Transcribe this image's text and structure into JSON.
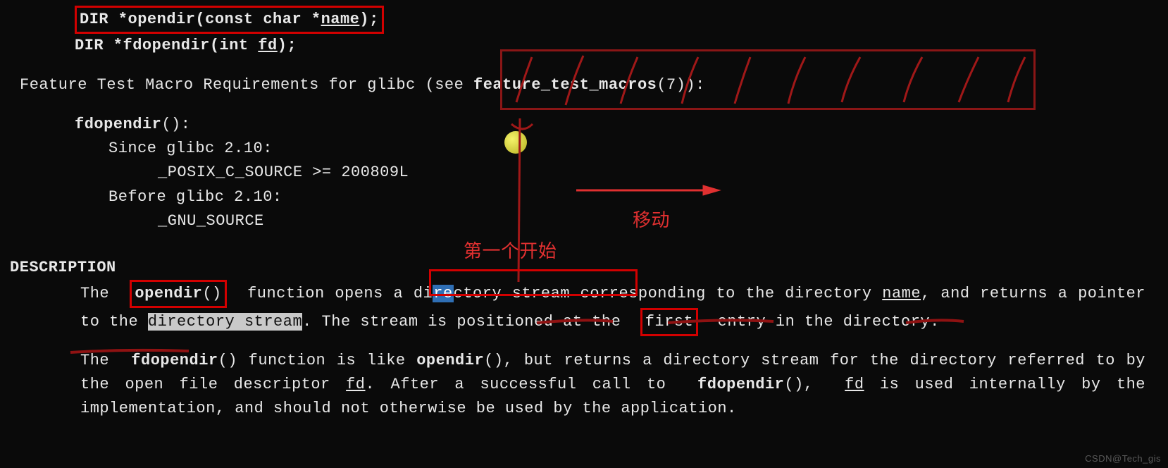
{
  "synopsis": {
    "line1_pre": "DIR *opendir(const char *",
    "line1_arg": "name",
    "line1_post": ");",
    "line2_pre": "DIR *fdopendir(int ",
    "line2_arg": "fd",
    "line2_post": ");"
  },
  "ftm_line_pre": "Feature Test Macro Requirements for glibc (see ",
  "ftm_bold": "feature_test_macros",
  "ftm_post": "(7)):",
  "macros": {
    "func": "fdopendir",
    "func_paren": "():",
    "since": "Since glibc 2.10:",
    "since_val": "_POSIX_C_SOURCE >= 200809L",
    "before": "Before glibc 2.10:",
    "before_val": "_GNU_SOURCE"
  },
  "desc_head": "DESCRIPTION",
  "desc1": {
    "p0": "The ",
    "opendir": "opendir",
    "p1": "() ",
    "p2": "function  opens  a  di",
    "sel": "re",
    "p3": "ctory stream",
    "p4": " corresponding to the directory ",
    "name": "name",
    "p5": ", and returns a pointer to the ",
    "hl": "directory stream",
    "p6": ". The stream is positioned at the ",
    "first": "first",
    "p7": " entry in the directory."
  },
  "desc2": {
    "p0": "The ",
    "fdopendir": "fdopendir",
    "p1": "() function is like ",
    "opendir": "opendir",
    "p2": "(), but returns a directory stream for the directory referred to by the open file descriptor ",
    "fd": "fd",
    "p3": ".  After a successful call to ",
    "fdopendir2": "fdopendir",
    "p4": "(), ",
    "fd2": "fd",
    "p5": " is used internally by the implementation, and should not otherwise be used by the application."
  },
  "annotations": {
    "note1": "第一个开始",
    "note2": "移动"
  },
  "watermark": "CSDN@Tech_gis"
}
